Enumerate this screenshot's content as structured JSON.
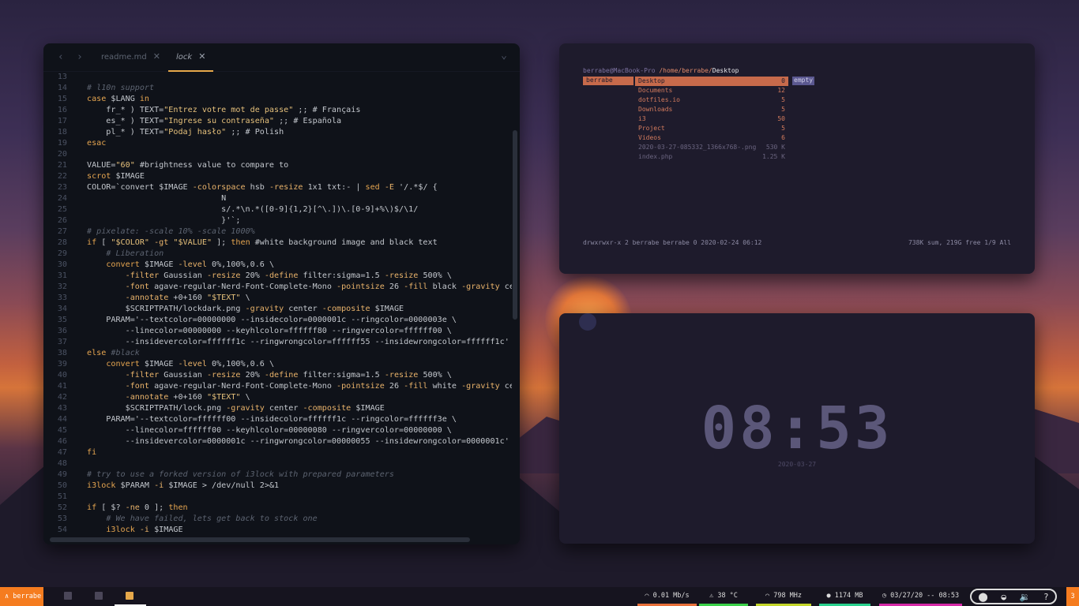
{
  "editor": {
    "tabs": [
      {
        "label": "readme.md",
        "active": false
      },
      {
        "label": "lock",
        "active": true
      }
    ],
    "lines": [
      {
        "n": "13",
        "t": ""
      },
      {
        "n": "14",
        "t": "# l10n support"
      },
      {
        "n": "15",
        "t": "case $LANG in"
      },
      {
        "n": "16",
        "t": "    fr_* ) TEXT=\"Entrez votre mot de passe\" ;; # Français"
      },
      {
        "n": "17",
        "t": "    es_* ) TEXT=\"Ingrese su contraseña\" ;; # Española"
      },
      {
        "n": "18",
        "t": "    pl_* ) TEXT=\"Podaj hasło\" ;; # Polish"
      },
      {
        "n": "19",
        "t": "esac"
      },
      {
        "n": "20",
        "t": ""
      },
      {
        "n": "21",
        "t": "VALUE=\"60\" #brightness value to compare to"
      },
      {
        "n": "22",
        "t": "scrot $IMAGE"
      },
      {
        "n": "23",
        "t": "COLOR=`convert $IMAGE -colorspace hsb -resize 1x1 txt:- | sed -E '/.*$/ {"
      },
      {
        "n": "24",
        "t": "                            N"
      },
      {
        "n": "25",
        "t": "                            s/.*\\n.*([0-9]{1,2}[^\\.])\\.[0-9]+%\\)$/\\1/"
      },
      {
        "n": "26",
        "t": "                            }'`;"
      },
      {
        "n": "27",
        "t": "# pixelate: -scale 10% -scale 1000%"
      },
      {
        "n": "28",
        "t": "if [ \"$COLOR\" -gt \"$VALUE\" ]; then #white background image and black text"
      },
      {
        "n": "29",
        "t": "    # Liberation"
      },
      {
        "n": "30",
        "t": "    convert $IMAGE -level 0%,100%,0.6 \\"
      },
      {
        "n": "31",
        "t": "        -filter Gaussian -resize 20% -define filter:sigma=1.5 -resize 500% \\"
      },
      {
        "n": "32",
        "t": "        -font agave-regular-Nerd-Font-Complete-Mono -pointsize 26 -fill black -gravity cen"
      },
      {
        "n": "33",
        "t": "        -annotate +0+160 \"$TEXT\" \\"
      },
      {
        "n": "34",
        "t": "        $SCRIPTPATH/lockdark.png -gravity center -composite $IMAGE"
      },
      {
        "n": "35",
        "t": "    PARAM='--textcolor=00000000 --insidecolor=0000001c --ringcolor=0000003e \\"
      },
      {
        "n": "36",
        "t": "        --linecolor=00000000 --keyhlcolor=ffffff80 --ringvercolor=ffffff00 \\"
      },
      {
        "n": "37",
        "t": "        --insidevercolor=ffffff1c --ringwrongcolor=ffffff55 --insidewrongcolor=ffffff1c'"
      },
      {
        "n": "38",
        "t": "else #black"
      },
      {
        "n": "39",
        "t": "    convert $IMAGE -level 0%,100%,0.6 \\"
      },
      {
        "n": "40",
        "t": "        -filter Gaussian -resize 20% -define filter:sigma=1.5 -resize 500% \\"
      },
      {
        "n": "41",
        "t": "        -font agave-regular-Nerd-Font-Complete-Mono -pointsize 26 -fill white -gravity cen"
      },
      {
        "n": "42",
        "t": "        -annotate +0+160 \"$TEXT\" \\"
      },
      {
        "n": "43",
        "t": "        $SCRIPTPATH/lock.png -gravity center -composite $IMAGE"
      },
      {
        "n": "44",
        "t": "    PARAM='--textcolor=ffffff00 --insidecolor=ffffff1c --ringcolor=ffffff3e \\"
      },
      {
        "n": "45",
        "t": "        --linecolor=ffffff00 --keyhlcolor=00000080 --ringvercolor=00000000 \\"
      },
      {
        "n": "46",
        "t": "        --insidevercolor=0000001c --ringwrongcolor=00000055 --insidewrongcolor=0000001c'"
      },
      {
        "n": "47",
        "t": "fi"
      },
      {
        "n": "48",
        "t": ""
      },
      {
        "n": "49",
        "t": "# try to use a forked version of i3lock with prepared parameters"
      },
      {
        "n": "50",
        "t": "i3lock $PARAM -i $IMAGE > /dev/null 2>&1"
      },
      {
        "n": "51",
        "t": ""
      },
      {
        "n": "52",
        "t": "if [ $? -ne 0 ]; then"
      },
      {
        "n": "53",
        "t": "    # We have failed, lets get back to stock one"
      },
      {
        "n": "54",
        "t": "    i3lock -i $IMAGE"
      }
    ]
  },
  "fm": {
    "user": "berrabe@MacBook-Pro",
    "path_prefix": "/home/berrabe/",
    "path_dir": "Desktop",
    "parent": "berrabe",
    "entries": [
      {
        "name": "Desktop",
        "size": "0",
        "kind": "sel"
      },
      {
        "name": "Documents",
        "size": "12",
        "kind": "dir"
      },
      {
        "name": "dotfiles.io",
        "size": "5",
        "kind": "dir"
      },
      {
        "name": "Downloads",
        "size": "5",
        "kind": "dir"
      },
      {
        "name": "i3",
        "size": "50",
        "kind": "dir"
      },
      {
        "name": "Project",
        "size": "5",
        "kind": "dir"
      },
      {
        "name": "Videos",
        "size": "6",
        "kind": "dir"
      },
      {
        "name": "2020-03-27-085332_1366x768-.png",
        "size": "530 K",
        "kind": "file"
      },
      {
        "name": "index.php",
        "size": "1.25 K",
        "kind": "file"
      }
    ],
    "preview": "empty",
    "status_left": "drwxrwxr-x 2 berrabe berrabe 0 2020-02-24 06:12",
    "status_right": "738K sum, 219G free  1/9  All"
  },
  "clock": {
    "time": "08:53",
    "date": "2020-03-27"
  },
  "bar": {
    "workspace": "berrabe",
    "workspace_right": "3",
    "modules": [
      {
        "label": "0.01 Mb/s",
        "color": "#e8703a"
      },
      {
        "label": "38 °C",
        "color": "#3bd14a"
      },
      {
        "label": "798 MHz",
        "color": "#c4d62a"
      },
      {
        "label": "1174 MB",
        "color": "#29d18e"
      },
      {
        "label": "03/27/20 -- 08:53",
        "color": "#d62aa8"
      }
    ]
  }
}
